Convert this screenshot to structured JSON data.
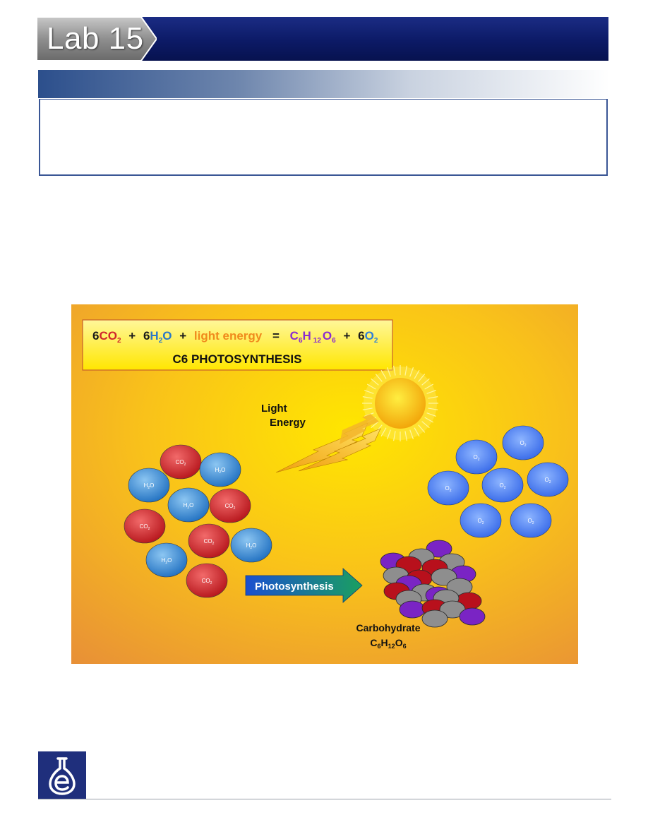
{
  "header": {
    "lab_title": "Lab 15"
  },
  "figure": {
    "equation": {
      "co2_coef": "6",
      "co2": "CO",
      "co2_sub": "2",
      "plus1": "+",
      "h2o_coef": "6",
      "h2o_h": "H",
      "h2o_sub": "2",
      "h2o_o": "O",
      "plus2": "+",
      "light": "light energy",
      "equals": "=",
      "glu_c": "C",
      "glu_c_sub": "6",
      "glu_h": "H",
      "glu_h_sub": "12",
      "glu_o": "O",
      "glu_o_sub": "6",
      "plus3": "+",
      "o2_coef": "6",
      "o2": "O",
      "o2_sub": "2"
    },
    "title": "C6 PHOTOSYNTHESIS",
    "light_label_1": "Light",
    "light_label_2": "Energy",
    "arrow_label": "Photosynthesis",
    "product_label": "Carbohydrate",
    "product_formula": {
      "c": "C",
      "c_sub": "6",
      "h": "H",
      "h_sub": "12",
      "o": "O",
      "o_sub": "6"
    },
    "molecule_labels": {
      "co2": "CO",
      "co2_sub": "2",
      "h2o_h": "H",
      "h2o_sub": "2",
      "h2o_o": "O",
      "o2": "O",
      "o2_sub": "2"
    }
  },
  "colors": {
    "banner": "#0c1a66",
    "co2_red": "#d0262c",
    "h2o_blue": "#2a78c8",
    "light_orange": "#f08a1c",
    "glucose_purple": "#8a2bd0",
    "o2_blue": "#2f7fd8"
  }
}
